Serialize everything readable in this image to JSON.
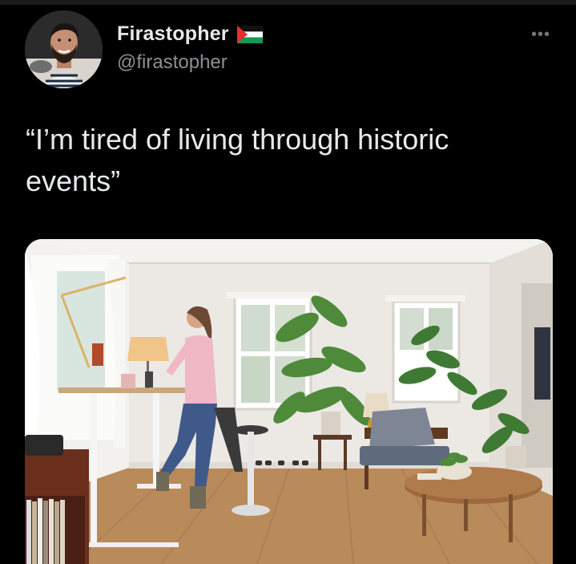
{
  "tweet": {
    "display_name": "Firastopher",
    "handle": "@firastopher",
    "flag_icon": "palestine-flag-icon",
    "more_label": "•••",
    "text": "“I’m tired of living through historic events”"
  },
  "media": {
    "description_icon": "photo-standing-desk-living-room"
  },
  "colors": {
    "background": "#000000",
    "primary_text": "#e7e9ea",
    "secondary_text": "#8b9096"
  }
}
